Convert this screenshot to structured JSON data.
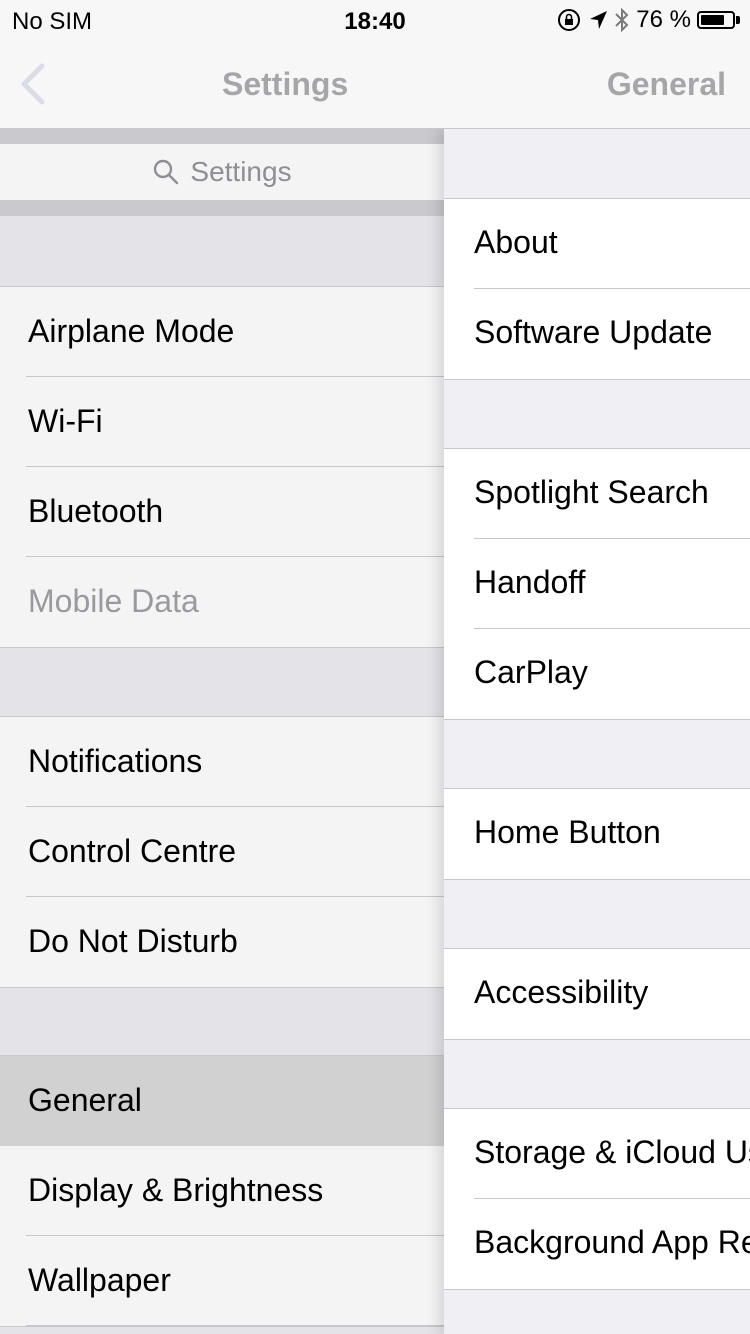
{
  "status_bar": {
    "carrier": "No SIM",
    "time": "18:40",
    "battery_percent": "76 %",
    "battery_level": 0.76,
    "icons": [
      "orientation-lock-icon",
      "location-arrow-icon",
      "bluetooth-icon",
      "battery-icon"
    ]
  },
  "nav": {
    "back_icon": "chevron-left-icon",
    "left_title": "Settings",
    "right_title": "General"
  },
  "search": {
    "placeholder": "Settings",
    "icon": "search-icon"
  },
  "settings_groups": [
    {
      "items": [
        {
          "label": "Airplane Mode"
        },
        {
          "label": "Wi-Fi"
        },
        {
          "label": "Bluetooth"
        },
        {
          "label": "Mobile Data",
          "disabled": true
        }
      ]
    },
    {
      "items": [
        {
          "label": "Notifications"
        },
        {
          "label": "Control Centre"
        },
        {
          "label": "Do Not Disturb"
        }
      ]
    },
    {
      "items": [
        {
          "label": "General",
          "selected": true
        },
        {
          "label": "Display & Brightness"
        },
        {
          "label": "Wallpaper"
        }
      ]
    }
  ],
  "general_groups": [
    {
      "items": [
        {
          "label": "About"
        },
        {
          "label": "Software Update"
        }
      ]
    },
    {
      "items": [
        {
          "label": "Spotlight Search"
        },
        {
          "label": "Handoff"
        },
        {
          "label": "CarPlay"
        }
      ]
    },
    {
      "items": [
        {
          "label": "Home Button"
        }
      ]
    },
    {
      "items": [
        {
          "label": "Accessibility"
        }
      ]
    },
    {
      "items": [
        {
          "label": "Storage & iCloud Usage"
        },
        {
          "label": "Background App Refresh"
        }
      ]
    }
  ]
}
